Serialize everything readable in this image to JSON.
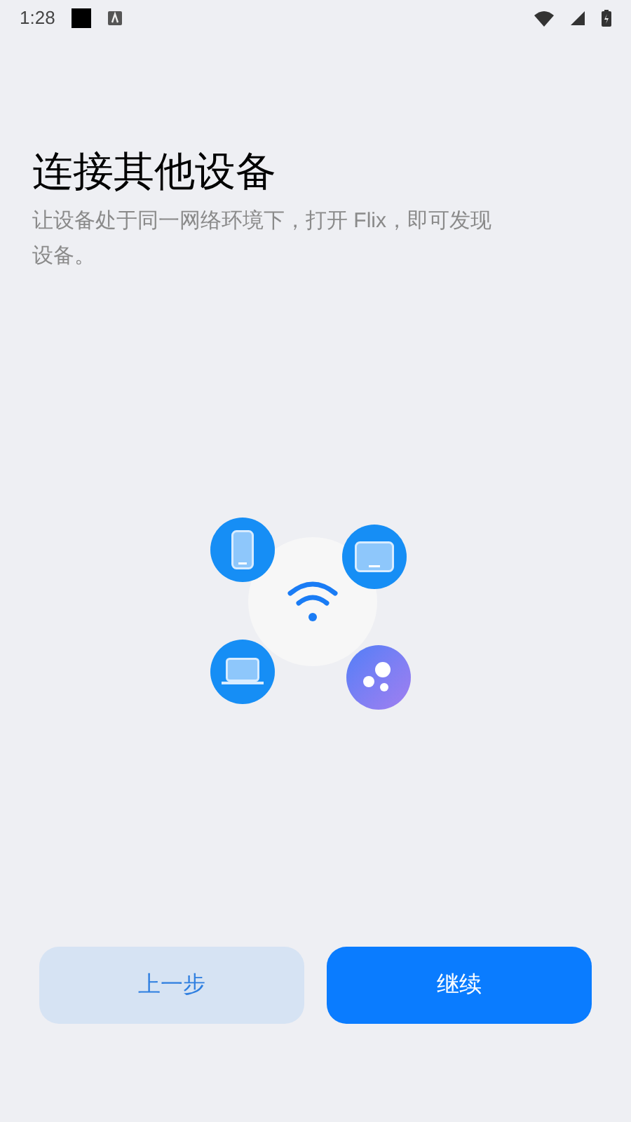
{
  "status_bar": {
    "time": "1:28"
  },
  "title": "连接其他设备",
  "description": "让设备处于同一网络环境下，打开 Flix，即可发现设备。",
  "buttons": [
    {
      "label": "上一步",
      "kind": "secondary"
    },
    {
      "label": "继续",
      "kind": "primary"
    }
  ]
}
